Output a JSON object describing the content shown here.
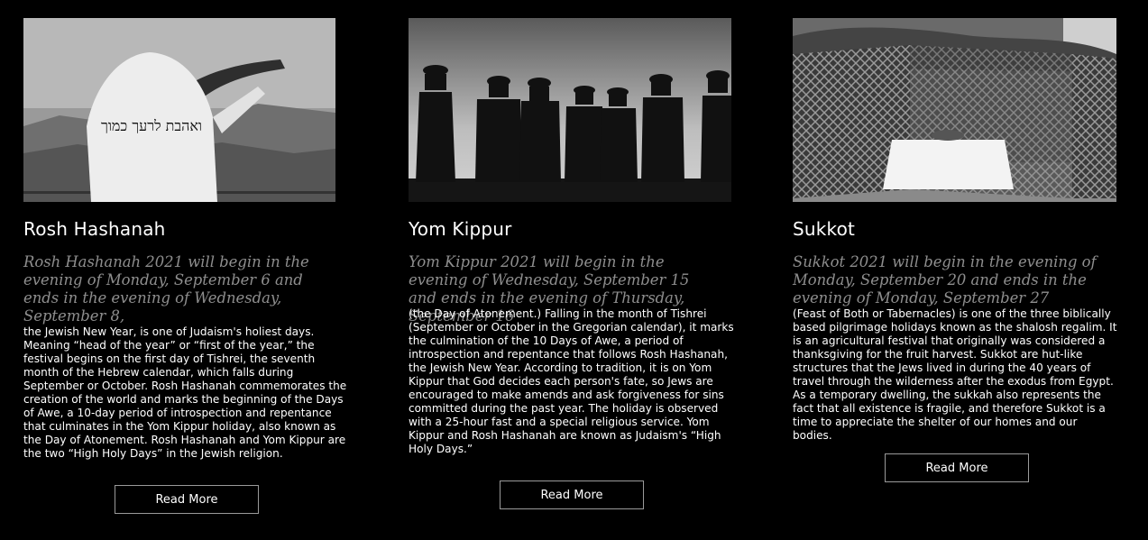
{
  "cards": [
    {
      "title": "Rosh Hashanah",
      "lead": "Rosh Hashanah 2021 will begin in the evening of Monday, September 6 and ends in the evening of Wednesday, September 8,",
      "body": "the Jewish New Year, is one of Judaism's holiest days. Meaning “head of the year” or “first of the year,” the festival begins on the first day of Tishrei, the seventh month of the Hebrew calendar, which falls during September or October. Rosh Hashanah commemorates the creation of the world and marks the beginning of the Days of Awe, a 10-day period of introspection and repentance that culminates in the Yom Kippur holiday, also known as the Day of Atonement. Rosh Hashanah and Yom Kippur are the two “High Holy Days” in the Jewish religion.",
      "button": "Read More",
      "image_text": "ואהבת לרעך כמוך"
    },
    {
      "title": "Yom Kippur",
      "lead": "Yom Kippur 2021 will begin in the evening of Wednesday, September 15 and ends in the evening of Thursday, September 16",
      "body": "(the Day of Atonement.) Falling in the month of Tishrei (September or October in the Gregorian calendar), it marks the culmination of the 10 Days of Awe, a period of introspection and repentance that follows Rosh Hashanah, the Jewish New Year. According to tradition, it is on Yom Kippur that God decides each person's fate, so Jews are encouraged to make amends and ask forgiveness for sins committed during the past year. The holiday is observed with a 25-hour fast and a special religious service. Yom Kippur and Rosh Hashanah are known as Judaism's “High Holy Days.”",
      "button": "Read More"
    },
    {
      "title": "Sukkot",
      "lead": "Sukkot 2021 will begin in the evening of Monday, September 20 and ends in the evening of Monday, September 27",
      "body": "(Feast of Both or Tabernacles) is one of the three biblically based pilgrimage holidays known as the shalosh regalim. It is an agricultural festival that originally was considered a thanksgiving for the fruit harvest. Sukkot are hut-like structures that the Jews lived in during the 40 years of travel through the wilderness after the exodus from Egypt. As a temporary dwelling, the sukkah also represents the fact that all existence is fragile, and therefore Sukkot is a time to appreciate the shelter of our homes and our bodies.",
      "button": "Read More"
    }
  ]
}
